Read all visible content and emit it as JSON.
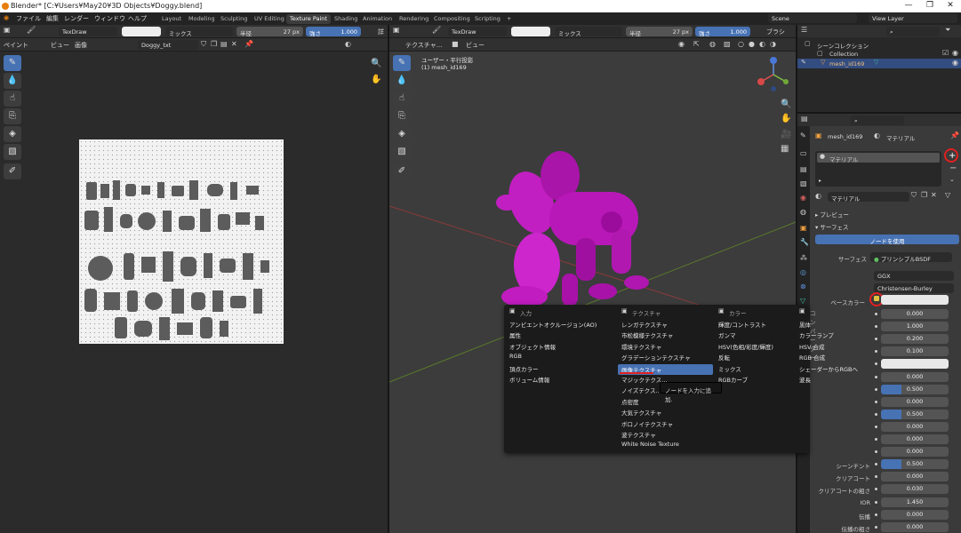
{
  "window": {
    "title": "Blender* [C:¥Users¥May20¥3D Objects¥Doggy.blend]",
    "controls": [
      "—",
      "❐",
      "✕"
    ]
  },
  "menu": [
    "ファイル",
    "編集",
    "レンダー",
    "ウィンドウ",
    "ヘルプ"
  ],
  "workspaces": [
    "Layout",
    "Modeling",
    "Sculpting",
    "UV Editing",
    "Texture Paint",
    "Shading",
    "Animation",
    "Rendering",
    "Compositing",
    "Scripting"
  ],
  "active_workspace": "Texture Paint",
  "scene": "Scene",
  "view_layer": "View Layer",
  "left_header": {
    "brush": "TexDraw",
    "blend": "ミックス",
    "radius_label": "半径",
    "radius": "27 px",
    "strength_label": "強さ",
    "strength": "1.000",
    "strength_short": "詳",
    "mode": "ペイント",
    "view": "ビュー",
    "image": "画像",
    "image_name": "Doggy_txt"
  },
  "viewport_header": {
    "mode": "テクスチャ...",
    "view": "ビュー",
    "brush": "TexDraw",
    "blend": "ミックス",
    "radius_label": "半径",
    "radius": "27 px",
    "strength_label": "強さ",
    "strength": "1.000",
    "brush_menu": "ブラシ"
  },
  "viewport_overlay": {
    "line1": "ユーザー・平行投影",
    "line2": "(1) mesh_id169"
  },
  "outliner": {
    "root": "シーンコレクション",
    "collection": "Collection",
    "object": "mesh_id169"
  },
  "properties": {
    "object": "mesh_id169",
    "material_tab": "マテリアル",
    "slot": "マテリアル",
    "material_name": "マテリアル",
    "preview": "プレビュー",
    "surface_section": "サーフェス",
    "use_nodes": "ノードを使用",
    "surface_label": "サーフェス",
    "surface_value": "プリンシプルBSDF",
    "distribution": "GGX",
    "subsurface_method": "Christensen-Burley",
    "base_color_label": "ベースカラー",
    "rows": [
      {
        "label": "",
        "value": "0.000"
      },
      {
        "label": "",
        "value": "1.000"
      },
      {
        "label": "",
        "value": "0.200"
      },
      {
        "label": "",
        "value": "0.100"
      },
      {
        "label": "",
        "value": ""
      },
      {
        "label": "",
        "value": "0.000"
      },
      {
        "label": "",
        "value": "0.500"
      },
      {
        "label": "",
        "value": "0.000"
      },
      {
        "label": "",
        "value": "0.500"
      },
      {
        "label": "",
        "value": "0.000"
      },
      {
        "label": "",
        "value": "0.000"
      },
      {
        "label": "",
        "value": "0.000"
      },
      {
        "label": "シーンチント",
        "value": "0.500"
      },
      {
        "label": "クリアコート",
        "value": "0.000"
      },
      {
        "label": "クリアコートの粗さ",
        "value": "0.030"
      },
      {
        "label": "IOR",
        "value": "1.450"
      },
      {
        "label": "伝播",
        "value": "0.000"
      },
      {
        "label": "伝播の粗さ",
        "value": "0.000"
      }
    ]
  },
  "add_menu": {
    "columns": [
      {
        "header": "入力",
        "items": [
          "アンビエントオクルージョン(AO)",
          "属性",
          "オブジェクト情報",
          "RGB",
          "頂点カラー",
          "ボリューム情報"
        ]
      },
      {
        "header": "テクスチャ",
        "items": [
          "レンガテクスチャ",
          "市松模様テクスチャ",
          "環境テクスチャ",
          "グラデーションテクスチャ",
          "画像テクスチャ",
          "マジックテクス...",
          "ノイズテクス...",
          "点密度",
          "大気テクスチャ",
          "ボロノイテクスチャ",
          "波テクスチャ",
          "White Noise Texture"
        ]
      },
      {
        "header": "カラー",
        "items": [
          "輝度/コントラスト",
          "ガンマ",
          "HSV(色相/彩度/輝度)",
          "反転",
          "ミックス",
          "RGBカーブ"
        ]
      },
      {
        "header": "コンバーター",
        "items": [
          "黒体",
          "カラーランプ",
          "HSV 合成",
          "RGB 合成",
          "シェーダーからRGBへ",
          "波長"
        ]
      }
    ],
    "highlighted": "画像テクスチャ",
    "tooltip": "ノードを入力に追加."
  },
  "colors": {
    "accent": "#4772b3",
    "mesh": "#c21fc2",
    "annotation": "#e02020"
  }
}
